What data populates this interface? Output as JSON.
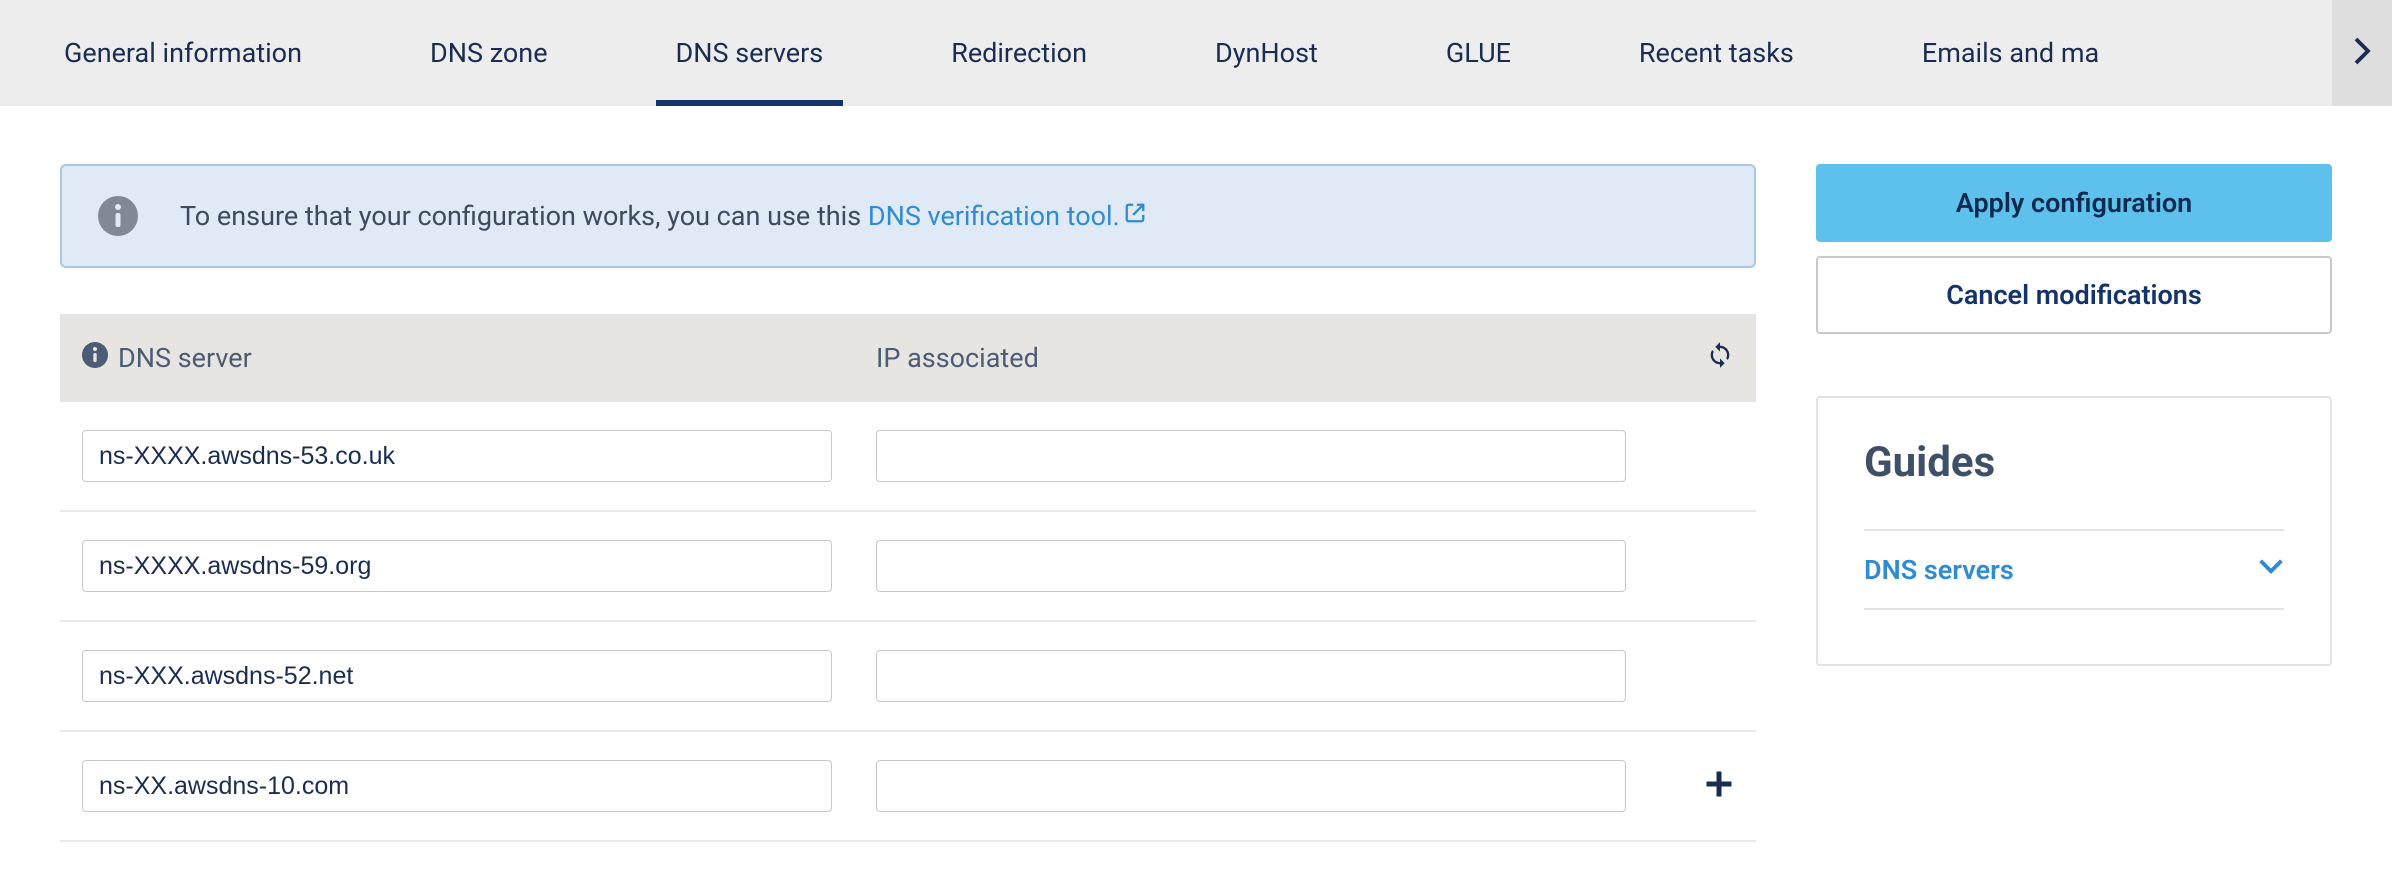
{
  "tabs": {
    "items": [
      {
        "label": "General information"
      },
      {
        "label": "DNS zone"
      },
      {
        "label": "DNS servers"
      },
      {
        "label": "Redirection"
      },
      {
        "label": "DynHost"
      },
      {
        "label": "GLUE"
      },
      {
        "label": "Recent tasks"
      },
      {
        "label": "Emails and ma"
      }
    ],
    "active_index": 2
  },
  "banner": {
    "text_before_link": "To ensure that your configuration works, you can use this ",
    "link_text": "DNS verification tool."
  },
  "table": {
    "header_col1": "DNS server",
    "header_col2": "IP associated",
    "rows": [
      {
        "server": "ns-XXXX.awsdns-53.co.uk",
        "ip": ""
      },
      {
        "server": "ns-XXXX.awsdns-59.org",
        "ip": ""
      },
      {
        "server": "ns-XXX.awsdns-52.net",
        "ip": ""
      },
      {
        "server": "ns-XX.awsdns-10.com",
        "ip": ""
      }
    ]
  },
  "sidebar": {
    "apply_label": "Apply configuration",
    "cancel_label": "Cancel modifications",
    "guides_title": "Guides",
    "guides_item_label": "DNS servers"
  }
}
